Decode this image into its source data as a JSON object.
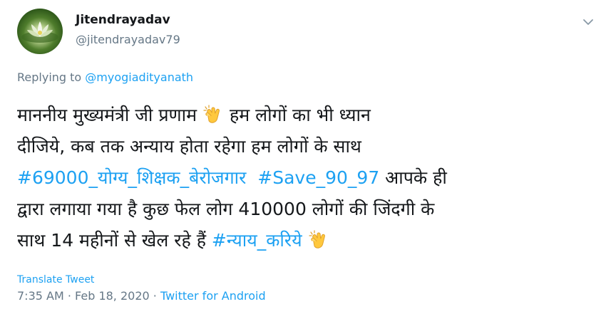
{
  "user": {
    "display_name": "Jitendrayadav",
    "handle": "@jitendrayadav79"
  },
  "reply": {
    "prefix": "Replying to ",
    "mention": "@myogiadityanath"
  },
  "tweet": {
    "line1_a": "माननीय मुख्यमंत्री जी प्रणाम ",
    "line1_b": " हम लोगों का भी ध्यान",
    "line2": "दीजिये,  कब तक अन्याय होता रहेगा हम लोगों के साथ",
    "hashtag1": "#69000_योग्य_शिक्षक_बेरोजगार",
    "hashtag2": "#Save_90_97",
    "line3_rest": " आपके ही",
    "line4": "द्वारा लगाया गया है कुछ फेल लोग 410000 लोगों की जिंदगी के",
    "line5_a": "साथ 14 महीनों से खेल रहे हैं ",
    "hashtag3": "#न्याय_करिये",
    "emoji": "clapping-hands"
  },
  "translate_label": "Translate Tweet",
  "meta": {
    "time": "7:35 AM",
    "separator": " · ",
    "date": "Feb 18, 2020",
    "source": "Twitter for Android"
  },
  "colors": {
    "link": "#1da1f2",
    "text": "#14171a",
    "secondary": "#657786"
  }
}
